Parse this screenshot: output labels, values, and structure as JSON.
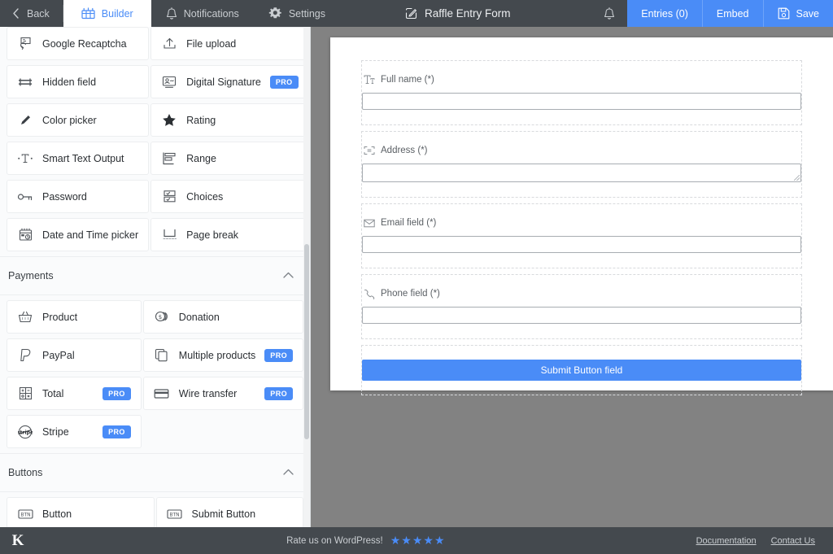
{
  "topbar": {
    "back_label": "Back",
    "builder_label": "Builder",
    "notifications_label": "Notifications",
    "settings_label": "Settings",
    "form_title": "Raffle Entry Form",
    "entries_label": "Entries (0)",
    "embed_label": "Embed",
    "save_label": "Save",
    "accent_color": "#4a8cf7",
    "bar_color": "#44494e"
  },
  "sidebar": {
    "fields_top": [
      {
        "label": "Google Recaptcha",
        "icon": "recaptcha-icon",
        "pro": false
      },
      {
        "label": "File upload",
        "icon": "upload-icon",
        "pro": false
      },
      {
        "label": "Hidden field",
        "icon": "hidden-field-icon",
        "pro": false
      },
      {
        "label": "Digital Signature",
        "icon": "signature-icon",
        "pro": true
      },
      {
        "label": "Color picker",
        "icon": "pencil-icon",
        "pro": false
      },
      {
        "label": "Rating",
        "icon": "star-icon",
        "pro": false
      },
      {
        "label": "Smart Text Output",
        "icon": "smart-text-icon",
        "pro": false
      },
      {
        "label": "Range",
        "icon": "range-icon",
        "pro": false
      },
      {
        "label": "Password",
        "icon": "key-icon",
        "pro": false
      },
      {
        "label": "Choices",
        "icon": "choices-icon",
        "pro": false
      },
      {
        "label": "Date and Time picker",
        "icon": "calendar-clock-icon",
        "pro": false
      },
      {
        "label": "Page break",
        "icon": "page-break-icon",
        "pro": false
      }
    ],
    "payments_section": {
      "title": "Payments",
      "collapse_icon": "chevron-up-icon",
      "items": [
        {
          "label": "Product",
          "icon": "basket-icon",
          "pro": false
        },
        {
          "label": "Donation",
          "icon": "coins-icon",
          "pro": false
        },
        {
          "label": "PayPal",
          "icon": "paypal-icon",
          "pro": false
        },
        {
          "label": "Multiple products",
          "icon": "copy-icon",
          "pro": true
        },
        {
          "label": "Total",
          "icon": "total-grid-icon",
          "pro": true
        },
        {
          "label": "Wire transfer",
          "icon": "credit-card-icon",
          "pro": true
        },
        {
          "label": "Stripe",
          "icon": "stripe-icon",
          "pro": true
        }
      ]
    },
    "buttons_section": {
      "title": "Buttons",
      "collapse_icon": "chevron-up-icon",
      "items": [
        {
          "label": "Button",
          "icon": "btn-icon",
          "pro": false
        },
        {
          "label": "Submit Button",
          "icon": "btn-icon",
          "pro": false
        }
      ]
    },
    "pro_badge_label": "PRO"
  },
  "form": {
    "fields": [
      {
        "label": "Full name (*)",
        "icon": "text-format-icon",
        "type": "text",
        "value": ""
      },
      {
        "label": "Address (*)",
        "icon": "address-icon",
        "type": "textarea",
        "value": ""
      },
      {
        "label": "Email field (*)",
        "icon": "envelope-icon",
        "type": "text",
        "value": ""
      },
      {
        "label": "Phone field (*)",
        "icon": "phone-icon",
        "type": "text",
        "value": ""
      }
    ],
    "submit_label": "Submit Button field",
    "submit_color": "#4a8cf7"
  },
  "bottombar": {
    "logo_text": "K",
    "rate_text": "Rate us on WordPress!",
    "stars": "★★★★★",
    "star_color": "#4a8cf7",
    "documentation_label": "Documentation",
    "contact_label": "Contact Us"
  }
}
